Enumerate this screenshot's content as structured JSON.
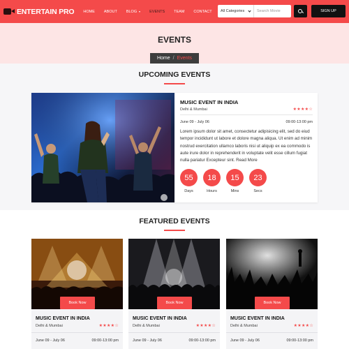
{
  "brand": {
    "name": "ENTERTAIN PRO"
  },
  "nav": {
    "items": [
      {
        "label": "HOME"
      },
      {
        "label": "ABOUT"
      },
      {
        "label": "BLOG"
      },
      {
        "label": "EVENTS"
      },
      {
        "label": "TEAM"
      },
      {
        "label": "CONTACT"
      }
    ],
    "active": "EVENTS"
  },
  "search": {
    "category": "All Categories",
    "placeholder": "Search Movie"
  },
  "signup_label": "SIGN UP",
  "hero": {
    "title": "EVENTS",
    "breadcrumb_home": "Home",
    "breadcrumb_separator": "/",
    "breadcrumb_current": "Events"
  },
  "upcoming": {
    "section_title": "UPCOMING EVENTS",
    "event": {
      "title": "MUSIC EVENT IN INDIA",
      "location": "Delhi & Mumbai",
      "rating": 4,
      "date": "June 09 - July 06",
      "time": "09:00-13:00 pm",
      "description": "Lorem ipsum dolor sit amet, consectetur adipisicing elit, sed do eiud tempor incididunt ut labore et dolore magna aliqua. Ut enim ad minim nostrud exercitation ullamco laboris nisi ut aliquip ex ea commodo is aute irure dolor in reprehenderit in voluptate velit esse cillum fugiat nulla pariatur Excepteur sint. Read More",
      "countdown": [
        {
          "value": "55",
          "label": "Days"
        },
        {
          "value": "18",
          "label": "Hours"
        },
        {
          "value": "15",
          "label": "Mins"
        },
        {
          "value": "23",
          "label": "Secs"
        }
      ]
    }
  },
  "featured": {
    "section_title": "FEATURED EVENTS",
    "events": [
      {
        "title": "MUSIC EVENT IN INDIA",
        "location": "Delhi & Mumbai",
        "rating": 4,
        "date": "June 09 - July 06",
        "time": "09:00-13:00 pm",
        "button": "Book Now"
      },
      {
        "title": "MUSIC EVENT IN INDIA",
        "location": "Delhi & Mumbai",
        "rating": 4,
        "date": "June 09 - July 06",
        "time": "09:00-13:00 pm",
        "button": "Book Now"
      },
      {
        "title": "MUSIC EVENT IN INDIA",
        "location": "Delhi & Mumbai",
        "rating": 4,
        "date": "June 09 - July 06",
        "time": "09:00-13:00 pm",
        "button": "Book Now"
      }
    ]
  },
  "colors": {
    "accent": "#f44a4a",
    "dark": "#111111",
    "hero_bg": "#fde5e5"
  }
}
